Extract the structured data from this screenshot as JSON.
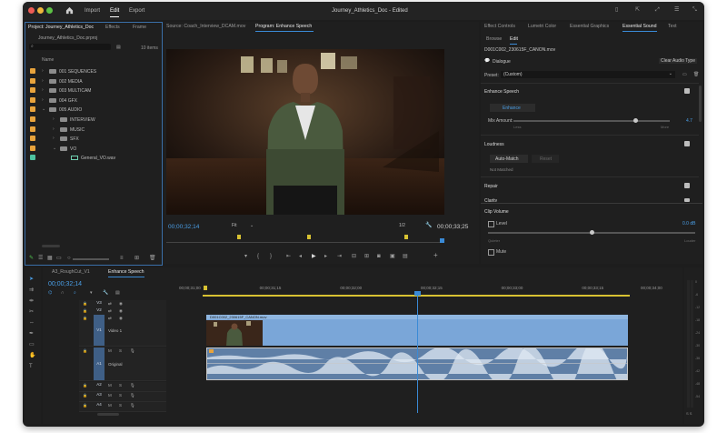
{
  "titlebar": {
    "title": "Journey_Athletics_Doc - Edited",
    "nav": [
      "Import",
      "Edit",
      "Export"
    ],
    "active_nav": "Edit"
  },
  "project_panel": {
    "tabs": [
      "Project: Journey_Athletics_Doc",
      "Effects",
      "Frame"
    ],
    "file": "Journey_Athletics_Doc.prproj",
    "search_placeholder": "",
    "item_count": "10 items",
    "column_name": "Name",
    "items": [
      {
        "label": "001 SEQUENCES",
        "depth": 0,
        "open": false
      },
      {
        "label": "002 MEDIA",
        "depth": 0,
        "open": false
      },
      {
        "label": "003 MULTICAM",
        "depth": 0,
        "open": false
      },
      {
        "label": "004 GFX",
        "depth": 0,
        "open": false
      },
      {
        "label": "005 AUDIO",
        "depth": 0,
        "open": true
      },
      {
        "label": "INTERVIEW",
        "depth": 1,
        "open": false
      },
      {
        "label": "MUSIC",
        "depth": 1,
        "open": false
      },
      {
        "label": "SFX",
        "depth": 1,
        "open": false
      },
      {
        "label": "VO",
        "depth": 1,
        "open": true
      },
      {
        "label": "General_VO.wav",
        "depth": 2,
        "open": false
      }
    ]
  },
  "monitor": {
    "source_tab": "Source: Coach_Interview_DCAM.mov",
    "program_tab": "Program: Enhance Speech",
    "timecode_current": "00;00;32;14",
    "fit_label": "Fit",
    "resolution": "1/2",
    "timecode_duration": "00;00;33;25"
  },
  "right_panel": {
    "tabs": [
      "Effect Controls",
      "Lumetri Color",
      "Essential Graphics",
      "Essential Sound",
      "Text"
    ],
    "active_tab": "Essential Sound",
    "subtabs": [
      "Browse",
      "Edit"
    ],
    "clip_name": "D001C002_230615F_CANON.mov",
    "dialogue_label": "Dialogue",
    "clear_label": "Clear Audio Type",
    "preset_label": "Preset:",
    "preset_value": "(Custom)",
    "enhance_speech": {
      "title": "Enhance Speech",
      "button": "Enhance",
      "mix_label": "Mix Amount:",
      "mix_value": "4.7",
      "mix_min": "Less",
      "mix_max": "More",
      "mix_fraction": 0.78
    },
    "loudness": {
      "title": "Loudness",
      "auto_match": "Auto-Match",
      "reset": "Reset",
      "status": "Not Matched"
    },
    "repair_title": "Repair",
    "clarity_title": "Clarity",
    "clip_volume": {
      "title": "Clip Volume",
      "level_label": "Level",
      "level_value": "0.0 dB",
      "min": "Quieter",
      "max": "Louder",
      "mute_label": "Mute",
      "level_fraction": 0.5
    }
  },
  "timeline": {
    "tabs": [
      "A3_RoughCut_V1",
      "Enhance Speech"
    ],
    "active_tab": "Enhance Speech",
    "timecode": "00;00;32;14",
    "ruler": [
      "00;00;31;00",
      "00;00;31;15",
      "00;00;32;00",
      "00;00;32;15",
      "00;00;33;00",
      "00;00;33;15",
      "00;00;34;00"
    ],
    "video_tracks": [
      {
        "id": "V3"
      },
      {
        "id": "V2"
      },
      {
        "id": "V1",
        "name": "Video 1"
      }
    ],
    "audio_tracks": [
      {
        "id": "A1",
        "name": "Original"
      },
      {
        "id": "A2"
      },
      {
        "id": "A3"
      },
      {
        "id": "A4"
      }
    ],
    "clip_name": "D001C002_230615F_CANON.mov",
    "meter_labels": [
      "0",
      "-6",
      "-12",
      "-18",
      "-24",
      "-30",
      "-36",
      "-42",
      "-48",
      "-54"
    ],
    "meter_footer": "S S"
  },
  "colors": {
    "accent": "#4a9ee6",
    "folder_label": "#e8a33c",
    "video_clip": "#7aa6d8",
    "audio_clip": "#5f7fa6",
    "playhead": "#3a8ad6"
  }
}
